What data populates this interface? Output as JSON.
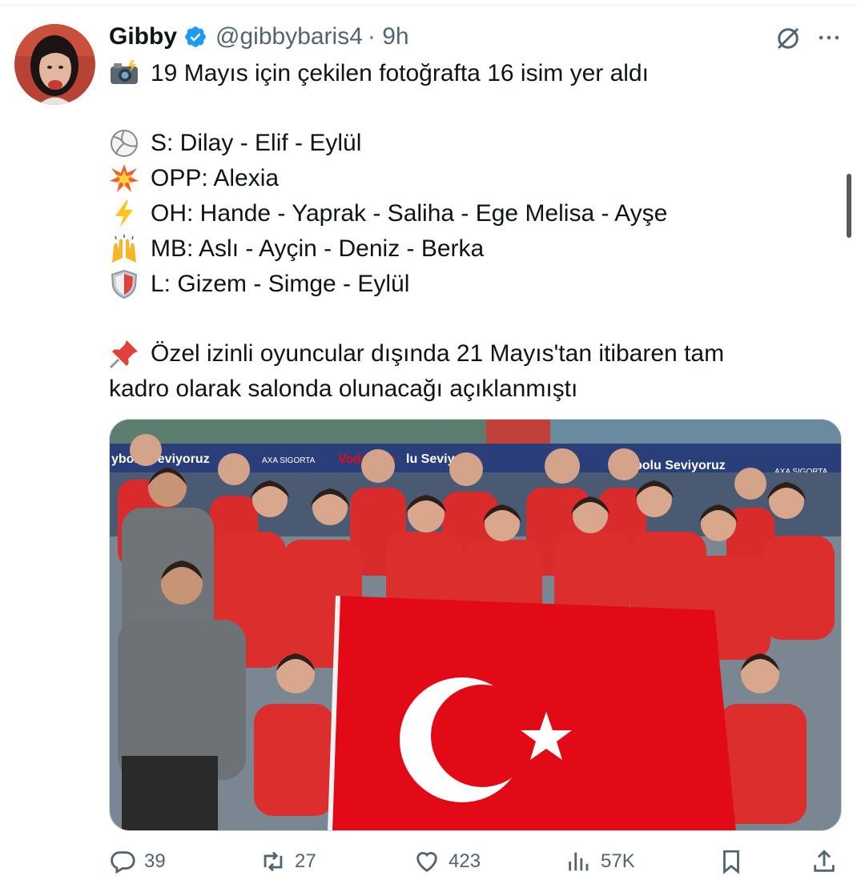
{
  "author": {
    "name": "Gibby",
    "handle": "@gibbybaris4",
    "time": "· 9h",
    "verified_color": "#1d9bf0"
  },
  "tweet": {
    "lines": [
      {
        "emoji": "camera-flash-emoji",
        "text": "19 Mayıs için çekilen fotoğrafta 16 isim yer aldı"
      },
      {
        "emoji": "volleyball-emoji",
        "text": "S: Dilay - Elif - Eylül"
      },
      {
        "emoji": "collision-emoji",
        "text": "OPP: Alexia"
      },
      {
        "emoji": "lightning-emoji",
        "text": "OH: Hande - Yaprak - Saliha - Ege Melisa - Ayşe"
      },
      {
        "emoji": "raised-hands-emoji",
        "text": "MB: Aslı - Ayçin - Deniz - Berka"
      },
      {
        "emoji": "shield-emoji",
        "text": "L: Gizem - Simge - Eylül"
      },
      {
        "emoji": "pushpin-emoji",
        "text": "Özel izinli oyuncular dışında 21 Mayıs'tan itibaren tam"
      },
      {
        "emoji": "",
        "text": "kadro olarak salonda olunacağı açıklanmıştı"
      }
    ]
  },
  "media": {
    "banner_left": "ybolu Seviyoruz",
    "banner_mid": "AXA SIGORTA",
    "banner_vf": "Vodafone",
    "banner_mid2": "lu Seviy",
    "banner_right": "bolu Seviyoruz",
    "banner_right2": "AXA SIGORTA"
  },
  "actions": {
    "replies": "39",
    "reposts": "27",
    "likes": "423",
    "views": "57K"
  },
  "colors": {
    "text": "#0f1419",
    "secondary": "#536471",
    "accent": "#1d9bf0",
    "flag_red": "#e30a17"
  }
}
